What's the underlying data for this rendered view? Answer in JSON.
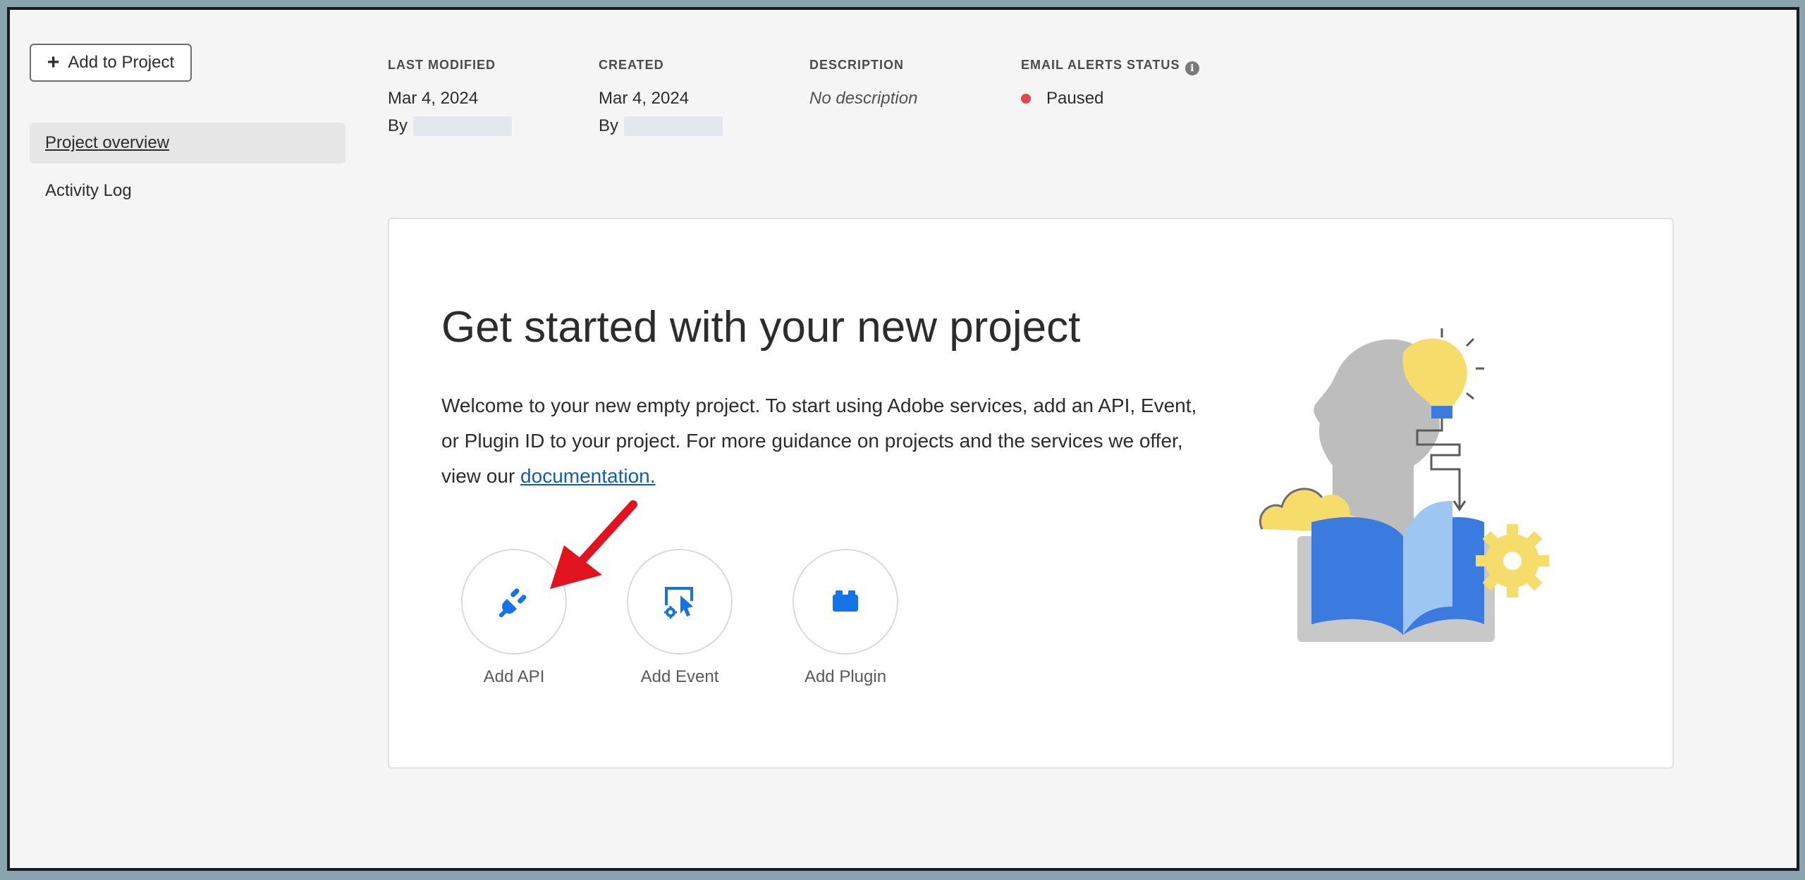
{
  "toolbar": {
    "add_to_project_label": "Add to Project"
  },
  "sidebar": {
    "items": [
      {
        "label": "Project overview",
        "active": true
      },
      {
        "label": "Activity Log",
        "active": false
      }
    ]
  },
  "meta": {
    "last_modified": {
      "label": "LAST MODIFIED",
      "date": "Mar 4, 2024",
      "by_prefix": "By"
    },
    "created": {
      "label": "CREATED",
      "date": "Mar 4, 2024",
      "by_prefix": "By"
    },
    "description": {
      "label": "DESCRIPTION",
      "value": "No description"
    },
    "email_alerts": {
      "label": "EMAIL ALERTS STATUS",
      "status": "Paused",
      "status_color": "#e34850"
    }
  },
  "card": {
    "title": "Get started with your new project",
    "body_text": "Welcome to your new empty project. To start using Adobe services, add an API, Event, or Plugin ID to your project. For more guidance on projects and the services we offer, view our ",
    "link_text": "documentation.",
    "actions": [
      {
        "label": "Add API",
        "icon": "plug-icon"
      },
      {
        "label": "Add Event",
        "icon": "event-icon"
      },
      {
        "label": "Add Plugin",
        "icon": "plugin-block-icon"
      }
    ]
  },
  "colors": {
    "accent": "#1473e6",
    "link": "#0d5eb8",
    "annotation_arrow": "#e0141e",
    "illustration_yellow": "#f6dd6b",
    "illustration_blue": "#3b7be0"
  }
}
